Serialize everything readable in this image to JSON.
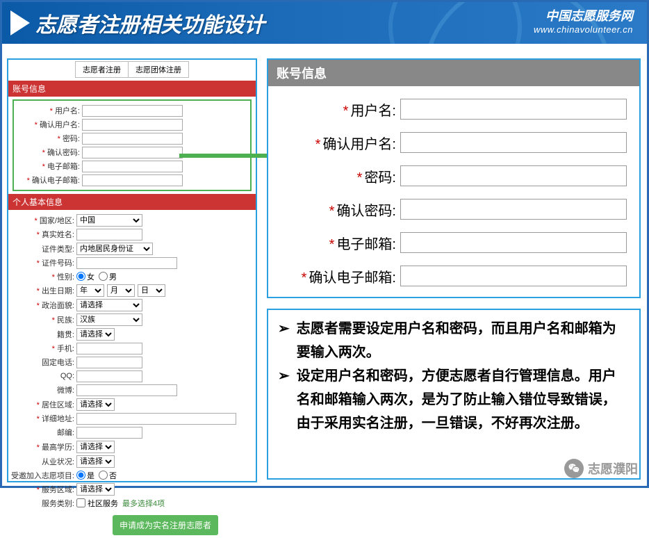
{
  "header": {
    "title": "志愿者注册相关功能设计",
    "brand_cn": "中国志愿服务网",
    "brand_url": "www.chinavolunteer.cn"
  },
  "left": {
    "tabs": [
      "志愿者注册",
      "志愿团体注册"
    ],
    "section_account": "账号信息",
    "section_personal": "个人基本信息",
    "account_fields": [
      {
        "label": "用户名:"
      },
      {
        "label": "确认用户名:"
      },
      {
        "label": "密码:"
      },
      {
        "label": "确认密码:"
      },
      {
        "label": "电子邮箱:"
      },
      {
        "label": "确认电子邮箱:"
      }
    ],
    "personal": {
      "country_lbl": "国家/地区:",
      "country_val": "中国",
      "realname_lbl": "真实姓名:",
      "idtype_lbl": "证件类型:",
      "idtype_val": "内地居民身份证",
      "idnum_lbl": "证件号码:",
      "gender_lbl": "性别:",
      "gender_f": "女",
      "gender_m": "男",
      "birth_lbl": "出生日期:",
      "year": "年",
      "month": "月",
      "day": "日",
      "polit_lbl": "政治面貌:",
      "select_ph": "请选择",
      "ethnic_lbl": "民族:",
      "ethnic_val": "汉族",
      "native_lbl": "籍贯:",
      "mobile_lbl": "手机:",
      "phone_lbl": "固定电话:",
      "qq_lbl": "QQ:",
      "weibo_lbl": "微博:",
      "region_lbl": "居住区域:",
      "addr_lbl": "详细地址:",
      "zip_lbl": "邮编:",
      "edu_lbl": "最高学历:",
      "job_lbl": "从业状况:",
      "invite_lbl": "受邀加入志愿项目:",
      "yes": "是",
      "no": "否",
      "svc_region_lbl": "服务区域:",
      "svc_type_lbl": "服务类别:",
      "svc_type_opt": "社区服务",
      "more": "最多选择4项"
    },
    "submit": "申请成为实名注册志愿者"
  },
  "zoom": {
    "title": "账号信息",
    "fields": [
      "用户名:",
      "确认用户名:",
      "密码:",
      "确认密码:",
      "电子邮箱:",
      "确认电子邮箱:"
    ]
  },
  "notes": [
    "志愿者需要设定用户名和密码，而且用户名和邮箱为要输入两次。",
    "设定用户名和密码，方便志愿者自行管理信息。用户名和邮箱输入两次，是为了防止输入错位导致错误，由于采用实名注册，一旦错误，不好再次注册。"
  ],
  "watermark": "志愿濮阳"
}
